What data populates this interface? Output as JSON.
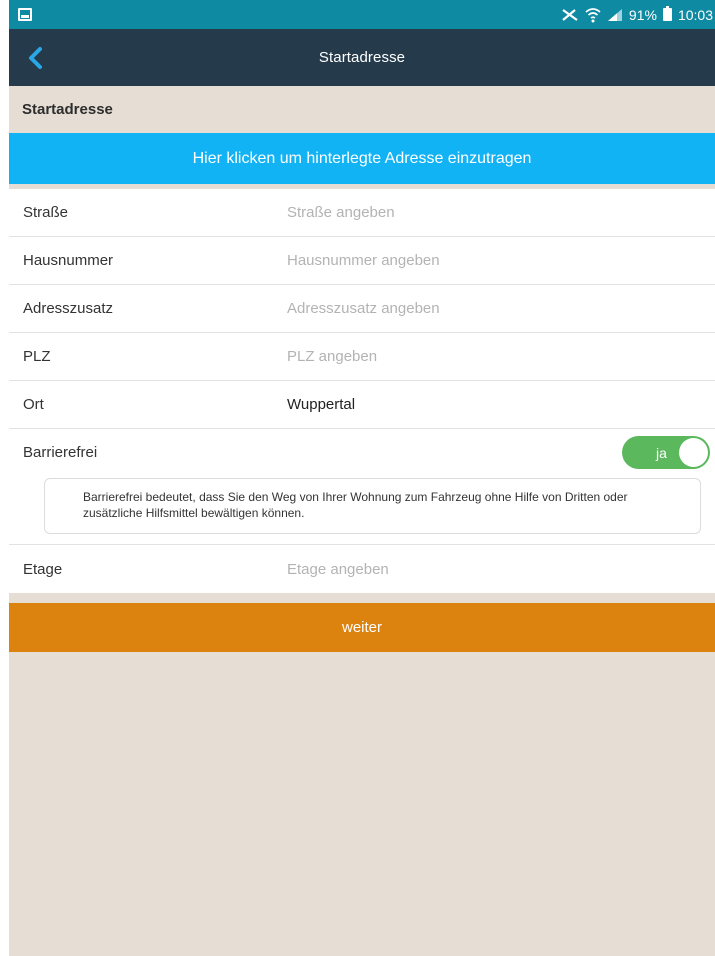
{
  "statusbar": {
    "battery_percent": "91%",
    "time": "10:03",
    "icons": [
      "screenshot-icon",
      "mute-icon",
      "wifi-icon",
      "signal-icon",
      "battery-icon"
    ]
  },
  "appbar": {
    "title": "Startadresse",
    "back_icon": "chevron-left-icon"
  },
  "section_title": "Startadresse",
  "cta_address_label": "Hier klicken um hinterlegte Adresse einzutragen",
  "fields": [
    {
      "label": "Straße",
      "placeholder": "Straße angeben",
      "value": ""
    },
    {
      "label": "Hausnummer",
      "placeholder": "Hausnummer angeben",
      "value": ""
    },
    {
      "label": "Adresszusatz",
      "placeholder": "Adresszusatz angeben",
      "value": ""
    },
    {
      "label": "PLZ",
      "placeholder": "PLZ angeben",
      "value": ""
    },
    {
      "label": "Ort",
      "placeholder": "",
      "value": "Wuppertal"
    }
  ],
  "barrierefrei": {
    "label": "Barrierefrei",
    "toggle_text": "ja",
    "toggle_on": true,
    "info": "Barrierefrei bedeutet, dass Sie den Weg von Ihrer Wohnung zum Fahrzeug ohne Hilfe von Dritten oder zusätzliche Hilfsmittel bewältigen können."
  },
  "etage": {
    "label": "Etage",
    "placeholder": "Etage angeben"
  },
  "next_button_label": "weiter",
  "colors": {
    "statusbar": "#0f8aa3",
    "appbar": "#253a4b",
    "accent_blue": "#12b3f4",
    "toggle_green": "#5bb85c",
    "next_orange": "#dc820e",
    "background": "#e6ded5"
  }
}
